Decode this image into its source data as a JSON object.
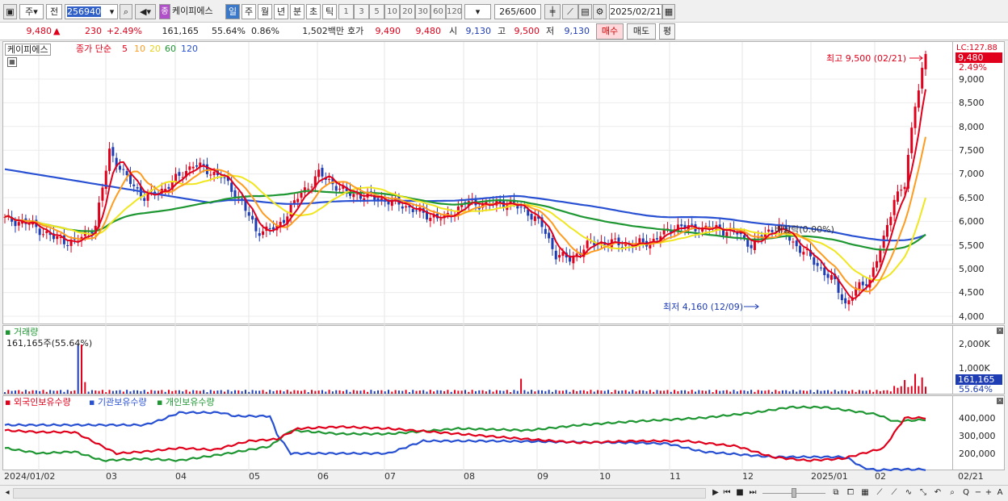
{
  "toolbar": {
    "type1": "주",
    "type2": "전",
    "code": "256940",
    "stock_name": "케이피에스",
    "badge": "종",
    "periods": [
      "일",
      "주",
      "월",
      "년",
      "분",
      "초",
      "틱"
    ],
    "intervals": [
      "1",
      "3",
      "5",
      "10",
      "20",
      "30",
      "60",
      "120"
    ],
    "count": "265",
    "count_total": "/600",
    "date": "2025/02/21"
  },
  "quote": {
    "price": "9,480",
    "arrow": "▲",
    "change": "230",
    "pct": "+2.49%",
    "volume": "161,165",
    "vol_pct": "55.64%",
    "turnover": "0.86%",
    "amount": "1,502백만",
    "hoga_label": "호가",
    "ask": "9,490",
    "bid": "9,480",
    "open_label": "시",
    "open": "9,130",
    "high_label": "고",
    "high": "9,500",
    "low_label": "저",
    "low": "9,130",
    "buy": "매수",
    "sell": "매도",
    "eval": "평"
  },
  "price_panel": {
    "name": "케이피에스",
    "ma_label": "종가 단순",
    "ma": [
      {
        "label": "5",
        "color": "#e0001b"
      },
      {
        "label": "10",
        "color": "#ff9b1e"
      },
      {
        "label": "20",
        "color": "#f0e61e"
      },
      {
        "label": "60",
        "color": "#1e9632"
      },
      {
        "label": "120",
        "color": "#2850d2"
      }
    ],
    "lc": "LC:127.88",
    "current": "9,480",
    "current_pct": "2.49%",
    "yticks": [
      "9,000",
      "8,500",
      "8,000",
      "7,500",
      "7,000",
      "6,500",
      "6,000",
      "5,500",
      "5,000",
      "4,500",
      "4,000"
    ],
    "max_note": "최고 9,500 (02/21)",
    "min_note": "최저 4,160 (12/09)",
    "dividend_note": "배당락(0.00%)"
  },
  "volume_panel": {
    "title": "거래량",
    "subtitle": "161,165주(55.64%)",
    "yticks": [
      "2,000K",
      "1,000K"
    ],
    "current": "161,165",
    "current_pct": "55.64%"
  },
  "holder_panel": {
    "labels": [
      {
        "text": "외국인보유수량",
        "color": "#e0001b"
      },
      {
        "text": "기관보유수량",
        "color": "#2850d2"
      },
      {
        "text": "개인보유수량",
        "color": "#1e9632"
      }
    ],
    "yticks": [
      "400,000",
      "300,000",
      "200,000"
    ]
  },
  "xaxis": [
    "2024/01/02",
    "03",
    "04",
    "05",
    "06",
    "07",
    "08",
    "09",
    "10",
    "11",
    "12",
    "2025/01",
    "02",
    "02/21"
  ],
  "colors": {
    "up": "#e0001b",
    "down": "#1e3cb4",
    "ma5": "#e0001b",
    "ma10": "#ff9b1e",
    "ma20": "#f0e61e",
    "ma60": "#1e9632",
    "ma120": "#2850d2"
  }
}
